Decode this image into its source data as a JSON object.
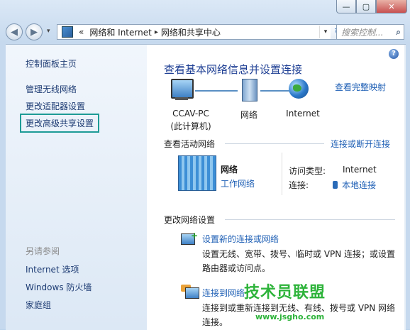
{
  "window": {
    "caption_buttons": {
      "minimize": "—",
      "maximize": "▢",
      "close": "✕"
    }
  },
  "navigation": {
    "back_icon": "back-arrow-icon",
    "forward_icon": "forward-arrow-icon",
    "breadcrumb": {
      "overflow": "«",
      "items": [
        "网络和 Internet",
        "网络和共享中心"
      ]
    },
    "search_placeholder": "搜索控制..."
  },
  "sidebar": {
    "items": [
      "控制面板主页",
      "管理无线网络",
      "更改适配器设置",
      "更改高级共享设置"
    ],
    "see_also_header": "另请参阅",
    "see_also": [
      "Internet 选项",
      "Windows 防火墙",
      "家庭组"
    ]
  },
  "main": {
    "title": "查看基本网络信息并设置连接",
    "full_map_link": "查看完整映射",
    "map_nodes": [
      {
        "label": "CCAV-PC",
        "sublabel": "(此计算机)"
      },
      {
        "label": "网络"
      },
      {
        "label": "Internet"
      }
    ],
    "active_networks": {
      "header": "查看活动网络",
      "toggle_link": "连接或断开连接",
      "network_name": "网络",
      "network_type": "工作网络",
      "access_type_label": "访问类型:",
      "access_type_value": "Internet",
      "connection_label": "连接:",
      "connection_value": "本地连接"
    },
    "change_settings": {
      "header": "更改网络设置",
      "tasks": [
        {
          "link": "设置新的连接或网络",
          "desc": "设置无线、宽带、拨号、临时或 VPN 连接；或设置路由器或访问点。"
        },
        {
          "link": "连接到网络",
          "desc": "连接到或重新连接到无线、有线、拨号或 VPN 网络连接。"
        }
      ]
    }
  },
  "watermark": {
    "text": "技术员联盟",
    "url": "www.jsgho.com"
  }
}
